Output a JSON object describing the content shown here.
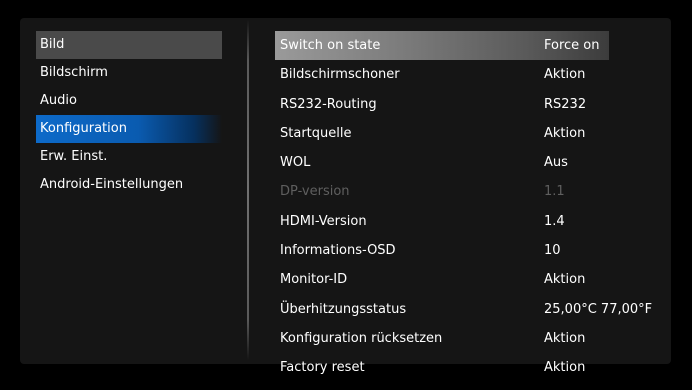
{
  "colors": {
    "background": "#000000",
    "panel": "#151515",
    "selected_category": "#0d6ac9",
    "highlight_row": "#8a8a8a",
    "disabled_text": "#5f5f5f"
  },
  "categories": [
    {
      "label": "Bild",
      "state": "highlighted"
    },
    {
      "label": "Bildschirm",
      "state": "normal"
    },
    {
      "label": "Audio",
      "state": "normal"
    },
    {
      "label": "Konfiguration",
      "state": "selected"
    },
    {
      "label": "Erw. Einst.",
      "state": "normal"
    },
    {
      "label": "Android-Einstellungen",
      "state": "normal"
    }
  ],
  "settings": [
    {
      "label": "Switch on state",
      "value": "Force on",
      "state": "highlighted"
    },
    {
      "label": "Bildschirmschoner",
      "value": "Aktion",
      "state": "normal"
    },
    {
      "label": "RS232-Routing",
      "value": "RS232",
      "state": "normal"
    },
    {
      "label": "Startquelle",
      "value": "Aktion",
      "state": "normal"
    },
    {
      "label": "WOL",
      "value": "Aus",
      "state": "normal"
    },
    {
      "label": "DP-version",
      "value": "1.1",
      "state": "disabled"
    },
    {
      "label": "HDMI-Version",
      "value": "1.4",
      "state": "normal"
    },
    {
      "label": "Informations-OSD",
      "value": "10",
      "state": "normal"
    },
    {
      "label": "Monitor-ID",
      "value": "Aktion",
      "state": "normal"
    },
    {
      "label": "Überhitzungsstatus",
      "value": "25,00°C 77,00°F",
      "state": "normal"
    },
    {
      "label": "Konfiguration rücksetzen",
      "value": "Aktion",
      "state": "normal"
    },
    {
      "label": "Factory reset",
      "value": "Aktion",
      "state": "normal"
    }
  ]
}
